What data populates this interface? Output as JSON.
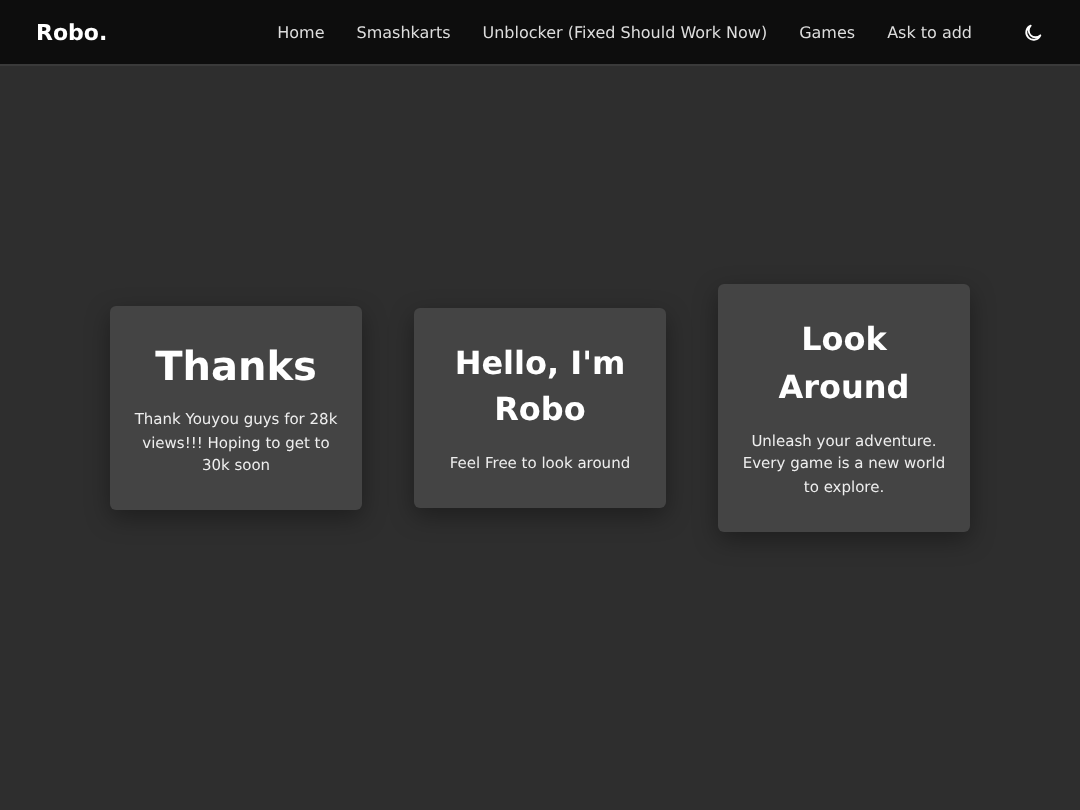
{
  "navbar": {
    "brand": "Robo.",
    "links": [
      "Home",
      "Smashkarts",
      "Unblocker (Fixed Should Work Now)",
      "Games",
      "Ask to add"
    ]
  },
  "cards": [
    {
      "kind": "large",
      "title": "Thanks",
      "text": "Thank Youyou guys for 28k views!!! Hoping to get to 30k soon"
    },
    {
      "kind": "normal",
      "title": "Hello, I'm Robo",
      "text": "Feel Free to look around"
    },
    {
      "kind": "normal",
      "title": "Look Around",
      "text": "Unleash your adventure. Every game is a new world to explore."
    }
  ]
}
